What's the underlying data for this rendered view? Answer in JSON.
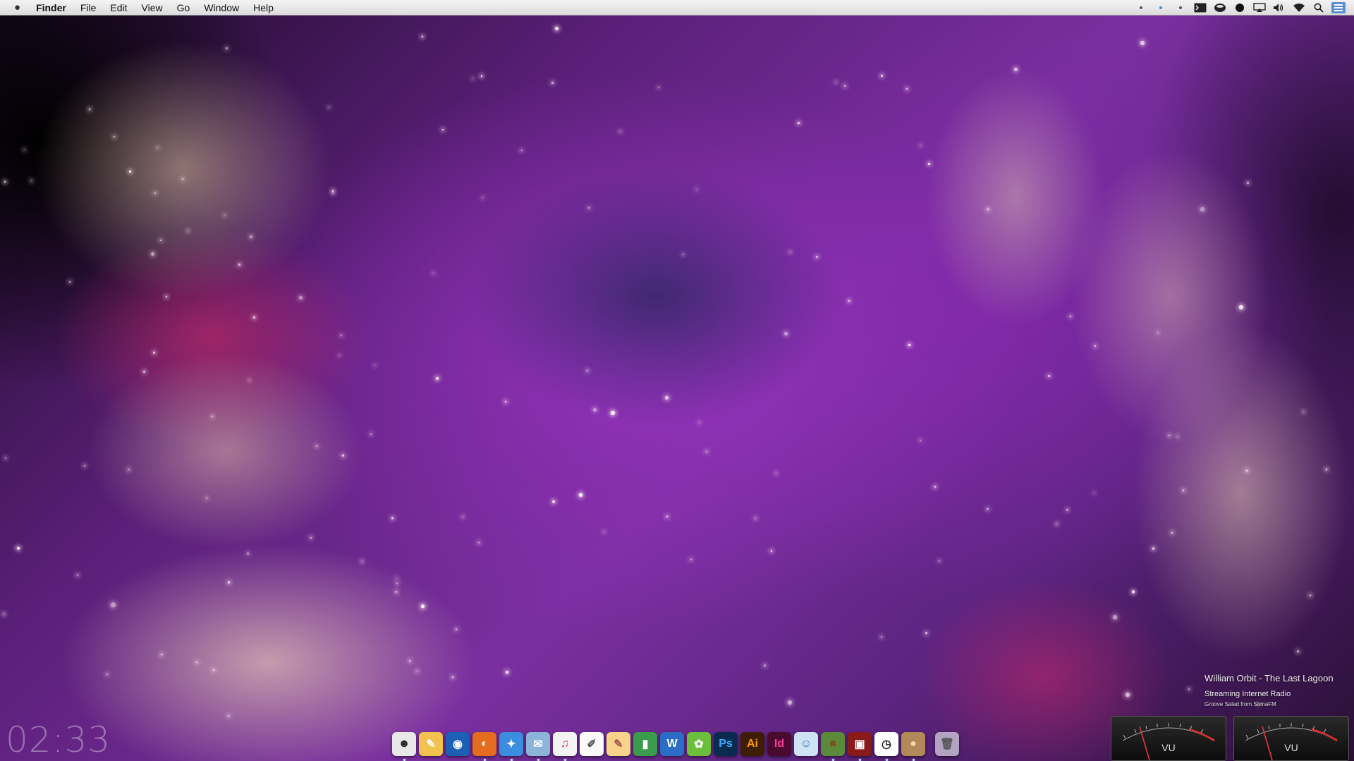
{
  "menubar": {
    "app_name": "Finder",
    "items": [
      "File",
      "Edit",
      "View",
      "Go",
      "Window",
      "Help"
    ],
    "status_icons": [
      "dot-icon",
      "dot-blue-icon",
      "dot-icon",
      "terminal-icon",
      "bowl-icon",
      "record-icon",
      "airplay-icon",
      "volume-icon",
      "wifi-icon",
      "spotlight-icon",
      "notification-icon"
    ]
  },
  "clock": {
    "time": "02:33"
  },
  "now_playing": {
    "track": "William Orbit - The Last Lagoon",
    "source": "Streaming Internet Radio",
    "station": "Groove Salad from SomaFM"
  },
  "vu_meters": [
    {
      "label": "VU"
    },
    {
      "label": "VU"
    }
  ],
  "dock": {
    "items": [
      {
        "name": "stormtrooper-icon",
        "glyph": "☻",
        "bg": "#e8e8e8",
        "fg": "#222",
        "running": true
      },
      {
        "name": "colorsync-icon",
        "glyph": "✎",
        "bg": "#f2c14e",
        "fg": "#fff",
        "running": false
      },
      {
        "name": "google-earth-icon",
        "glyph": "◉",
        "bg": "#1d5fb4",
        "fg": "#fff",
        "running": false
      },
      {
        "name": "firefox-icon",
        "glyph": "◐",
        "bg": "#e46c1e",
        "fg": "#fff",
        "running": true
      },
      {
        "name": "safari-icon",
        "glyph": "✦",
        "bg": "#3b8de0",
        "fg": "#fff",
        "running": true
      },
      {
        "name": "mail-icon",
        "glyph": "✉",
        "bg": "#8cb4d8",
        "fg": "#fff",
        "running": true
      },
      {
        "name": "itunes-icon",
        "glyph": "♫",
        "bg": "#f3f3f3",
        "fg": "#e23a6e",
        "running": true
      },
      {
        "name": "textedit-icon",
        "glyph": "✐",
        "bg": "#fafafa",
        "fg": "#555",
        "running": false
      },
      {
        "name": "pages-icon",
        "glyph": "✎",
        "bg": "#f7d48a",
        "fg": "#a55",
        "running": false
      },
      {
        "name": "numbers-icon",
        "glyph": "▮",
        "bg": "#3a9b4c",
        "fg": "#fff",
        "running": false
      },
      {
        "name": "word-icon",
        "glyph": "W",
        "bg": "#2b6cc4",
        "fg": "#fff",
        "running": false
      },
      {
        "name": "sketchup-icon",
        "glyph": "✿",
        "bg": "#6bbf3a",
        "fg": "#fff",
        "running": false
      },
      {
        "name": "photoshop-icon",
        "glyph": "Ps",
        "bg": "#0a2a50",
        "fg": "#3ab0ff",
        "running": false
      },
      {
        "name": "illustrator-icon",
        "glyph": "Ai",
        "bg": "#3d1e00",
        "fg": "#ff9a00",
        "running": false
      },
      {
        "name": "indesign-icon",
        "glyph": "Id",
        "bg": "#4a0a30",
        "fg": "#ff3c9a",
        "running": false
      },
      {
        "name": "finder-icon",
        "glyph": "☺",
        "bg": "#cfe3f5",
        "fg": "#2a6fb4",
        "running": false
      },
      {
        "name": "minecraft-icon",
        "glyph": "■",
        "bg": "#5b8a3a",
        "fg": "#7a5228",
        "running": true
      },
      {
        "name": "camera-icon",
        "glyph": "▣",
        "bg": "#8a1a1a",
        "fg": "#fff",
        "running": true
      },
      {
        "name": "clock-icon",
        "glyph": "◷",
        "bg": "#ffffff",
        "fg": "#222",
        "running": true
      },
      {
        "name": "planet-icon",
        "glyph": "●",
        "bg": "#b28a5a",
        "fg": "#f3d9a8",
        "running": true
      },
      {
        "name": "trash-icon",
        "glyph": "🗑",
        "bg": "rgba(220,220,230,0.7)",
        "fg": "#555",
        "running": false
      }
    ]
  }
}
